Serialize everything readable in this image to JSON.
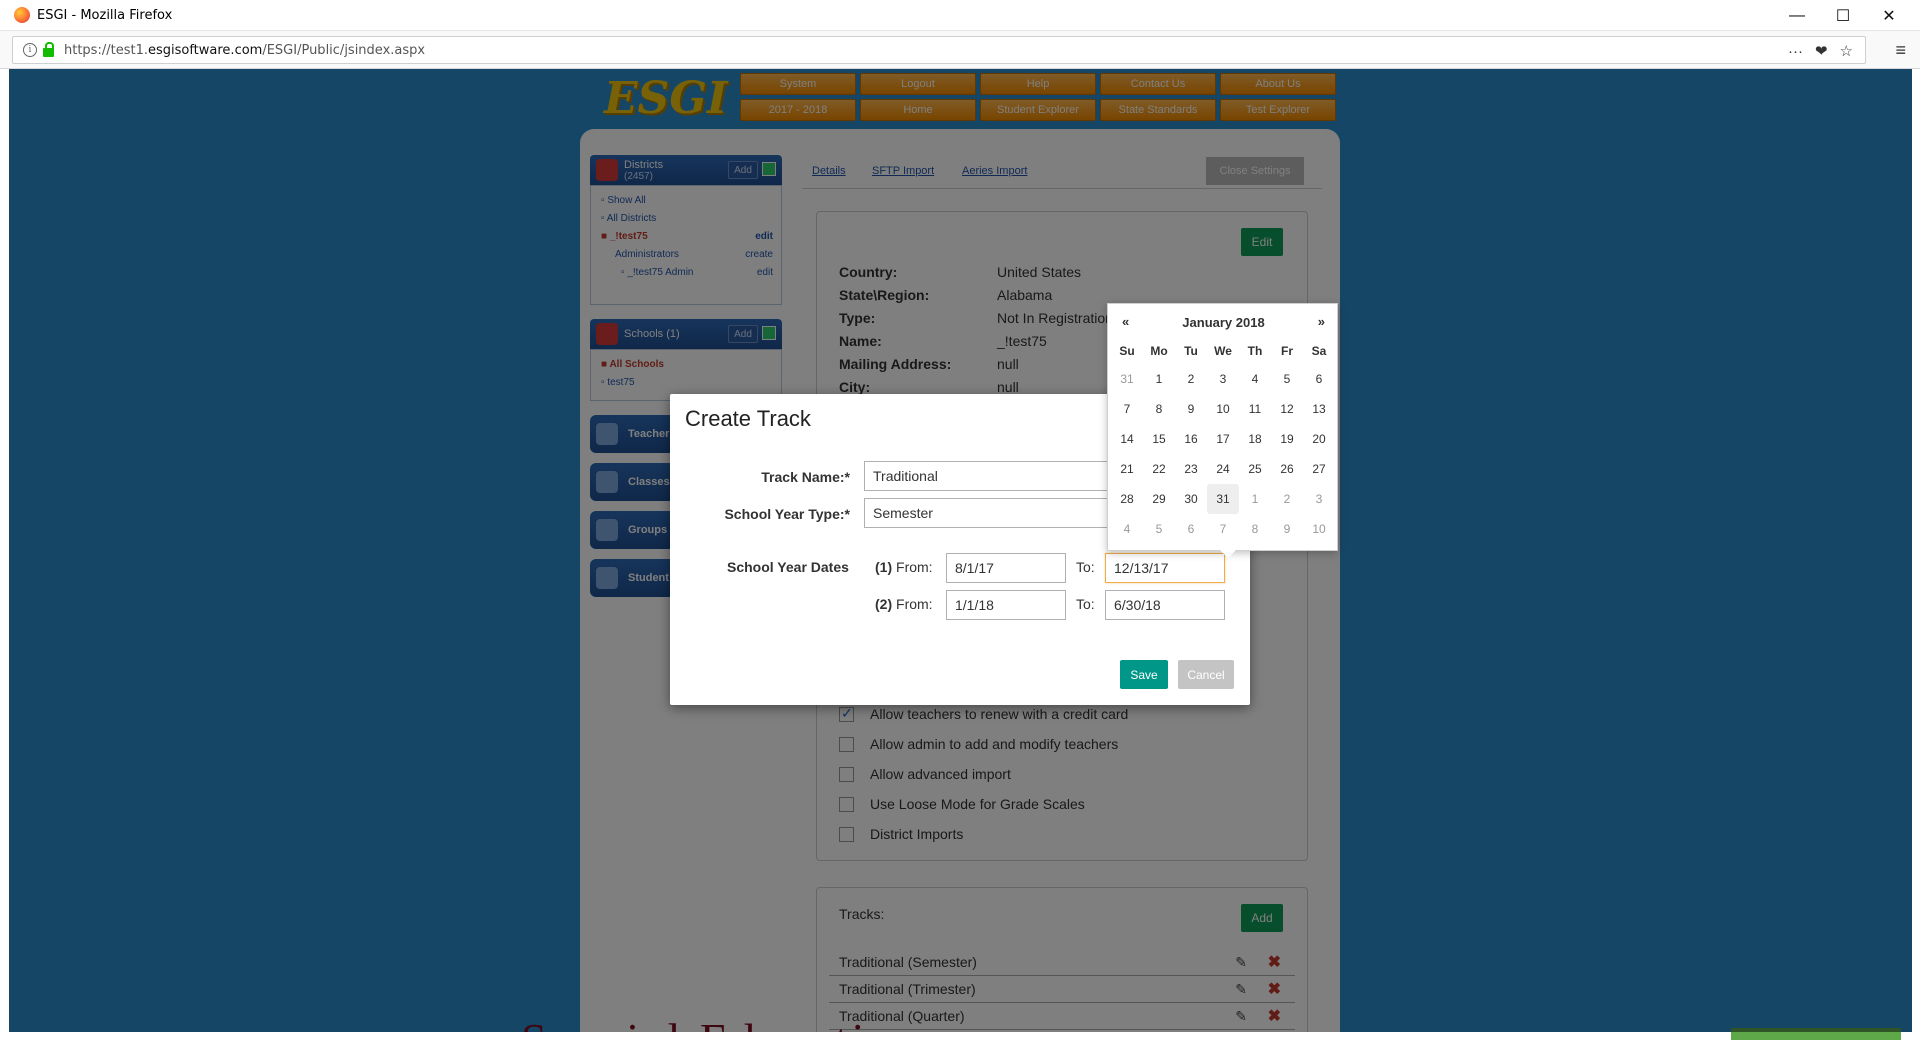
{
  "browser": {
    "window_title": "ESGI - Mozilla Firefox",
    "url_prefix": "https://test1.",
    "url_host": "esgisoftware.com",
    "url_path": "/ESGI/Public/jsindex.aspx",
    "more_icon": "···",
    "pocket_icon": "❤",
    "bookmark_icon": "☆",
    "menu_icon": "≡",
    "minimize": "—",
    "maximize": "☐",
    "close": "✕"
  },
  "app": {
    "logo": "ESGI",
    "nav": [
      "System",
      "Logout",
      "Help",
      "Contact Us",
      "About Us",
      "2017 - 2018",
      "Home",
      "Student Explorer",
      "State Standards",
      "Test Explorer"
    ],
    "districts": {
      "title": "Districts",
      "count": "(2457)",
      "add": "Add",
      "items": [
        {
          "label": "Show All",
          "action": ""
        },
        {
          "label": "All Districts",
          "action": ""
        },
        {
          "label": "_!test75",
          "action": "edit"
        },
        {
          "label": "Administrators",
          "action": "create"
        },
        {
          "label": "_!test75 Admin",
          "action": "edit"
        }
      ]
    },
    "schools": {
      "title": "Schools",
      "count": "(1)",
      "add": "Add",
      "items": [
        "All Schools",
        "test75"
      ]
    },
    "side_pills": [
      "Teacher",
      "Classes",
      "Groups",
      "Student"
    ],
    "tabs": [
      "Details",
      "SFTP Import",
      "Aeries Import"
    ],
    "close_settings": "Close Settings",
    "edit": "Edit",
    "details": [
      {
        "k": "Country:",
        "v": "United States"
      },
      {
        "k": "State\\Region:",
        "v": "Alabama"
      },
      {
        "k": "Type:",
        "v": "Not In Registration"
      },
      {
        "k": "Name:",
        "v": "_!test75"
      },
      {
        "k": "Mailing Address:",
        "v": "null"
      },
      {
        "k": "City:",
        "v": "null"
      }
    ],
    "checkboxes": [
      {
        "label": "Allow teachers to renew with a credit card",
        "checked": true
      },
      {
        "label": "Allow admin to add and modify teachers",
        "checked": false
      },
      {
        "label": "Allow advanced import",
        "checked": false
      },
      {
        "label": "Use Loose Mode for Grade Scales",
        "checked": false
      },
      {
        "label": "District Imports",
        "checked": false
      }
    ],
    "tracks": {
      "title": "Tracks:",
      "add": "Add",
      "rows": [
        "Traditional (Semester)",
        "Traditional (Trimester)",
        "Traditional (Quarter)"
      ]
    },
    "background_text": "Special Education"
  },
  "modal": {
    "title": "Create Track",
    "track_name_label": "Track Name:*",
    "track_name_value": "Traditional",
    "school_year_type_label": "School Year Type:*",
    "school_year_type_value": "Semester",
    "school_year_dates_label": "School Year Dates",
    "period1_num": "(1)",
    "period2_num": "(2)",
    "from_label": "From:",
    "to_label": "To:",
    "period1_from": "8/1/17",
    "period1_to": "12/13/17",
    "period2_from": "1/1/18",
    "period2_to": "6/30/18",
    "save": "Save",
    "cancel": "Cancel"
  },
  "datepicker": {
    "prev": "«",
    "next": "»",
    "month": "January 2018",
    "dow": [
      "Su",
      "Mo",
      "Tu",
      "We",
      "Th",
      "Fr",
      "Sa"
    ],
    "weeks": [
      [
        "31",
        "1",
        "2",
        "3",
        "4",
        "5",
        "6"
      ],
      [
        "7",
        "8",
        "9",
        "10",
        "11",
        "12",
        "13"
      ],
      [
        "14",
        "15",
        "16",
        "17",
        "18",
        "19",
        "20"
      ],
      [
        "21",
        "22",
        "23",
        "24",
        "25",
        "26",
        "27"
      ],
      [
        "28",
        "29",
        "30",
        "31",
        "1",
        "2",
        "3"
      ],
      [
        "4",
        "5",
        "6",
        "7",
        "8",
        "9",
        "10"
      ]
    ],
    "active_day": "31"
  }
}
